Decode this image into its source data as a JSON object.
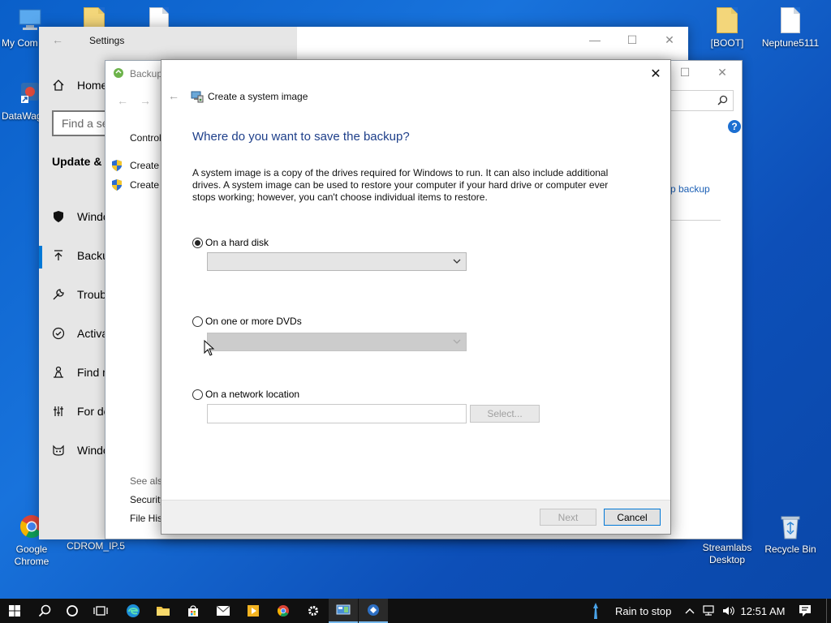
{
  "desktop": {
    "icons": [
      {
        "label": "My Com",
        "icon": "computer-icon"
      },
      {
        "label": "DataWag",
        "icon": "app-shortcut-icon"
      },
      {
        "label": "Google Chrome",
        "icon": "chrome-icon"
      },
      {
        "label": "CDROM_IP.5",
        "icon": "disc-icon"
      },
      {
        "label": "[BOOT]",
        "icon": "folder-file-icon"
      },
      {
        "label": "Neptune5111",
        "icon": "document-icon"
      },
      {
        "label": "Streamlabs Desktop",
        "icon": "streamlabs-icon"
      },
      {
        "label": "Recycle Bin",
        "icon": "recycle-bin-icon"
      }
    ]
  },
  "settings": {
    "title": "Settings",
    "home": "Home",
    "search_placeholder": "Find a se",
    "section": "Update & ",
    "nav": [
      {
        "label": "Windo",
        "icon": "shield-icon"
      },
      {
        "label": "Backu",
        "icon": "backup-arrow-icon"
      },
      {
        "label": "Troub",
        "icon": "wrench-icon"
      },
      {
        "label": "Activa",
        "icon": "check-circle-icon"
      },
      {
        "label": "Find m",
        "icon": "person-locate-icon"
      },
      {
        "label": "For de",
        "icon": "developer-tools-icon"
      },
      {
        "label": "Windo",
        "icon": "insider-cat-icon"
      }
    ],
    "right_link": "p backup"
  },
  "backup_window": {
    "title": "Backup",
    "control_panel": "Control",
    "links": [
      "Create a",
      "Create a"
    ],
    "see_also": "See also",
    "see_also_links": [
      "Security",
      "File Hist"
    ]
  },
  "dialog": {
    "header": "Create a system image",
    "heading": "Where do you want to save the backup?",
    "description": "A system image is a copy of the drives required for Windows to run. It can also include additional drives. A system image can be used to restore your computer if your hard drive or computer ever stops working; however, you can't choose individual items to restore.",
    "options": {
      "hard_disk": {
        "label": "On a hard disk",
        "checked": true,
        "value": ""
      },
      "dvds": {
        "label": "On one or more DVDs",
        "checked": false,
        "value": ""
      },
      "network": {
        "label": "On a network location",
        "checked": false,
        "value": ""
      }
    },
    "select_button": "Select...",
    "next_button": "Next",
    "cancel_button": "Cancel"
  },
  "taskbar": {
    "weather": "Rain to stop",
    "time": "12:51 AM"
  }
}
